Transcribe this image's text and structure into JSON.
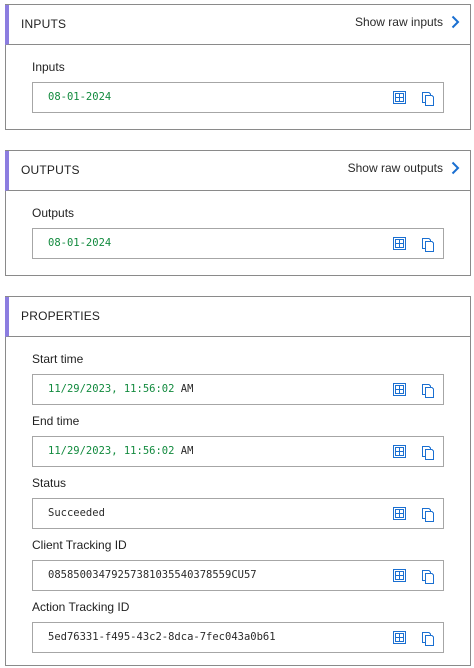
{
  "inputs": {
    "title": "INPUTS",
    "raw_link": "Show raw inputs",
    "field_label": "Inputs",
    "value": "08-01-2024"
  },
  "outputs": {
    "title": "OUTPUTS",
    "raw_link": "Show raw outputs",
    "field_label": "Outputs",
    "value": "08-01-2024"
  },
  "properties": {
    "title": "PROPERTIES",
    "start_time": {
      "label": "Start time",
      "value": "11/29/2023, 11:56:02",
      "suffix": "AM"
    },
    "end_time": {
      "label": "End time",
      "value": "11/29/2023, 11:56:02",
      "suffix": "AM"
    },
    "status": {
      "label": "Status",
      "value": "Succeeded"
    },
    "client_tracking_id": {
      "label": "Client Tracking ID",
      "value": "08585003479257381035540378559CU57"
    },
    "action_tracking_id": {
      "label": "Action Tracking ID",
      "value": "5ed76331-f495-43c2-8dca-7fec043a0b61"
    }
  },
  "icons": {
    "expand": "chevron-right-icon",
    "table": "table-view-icon",
    "copy": "copy-icon"
  },
  "colors": {
    "accent_bar": "#8c7de0",
    "link_chevron": "#1a6fd1",
    "value_green": "#128a3e"
  }
}
